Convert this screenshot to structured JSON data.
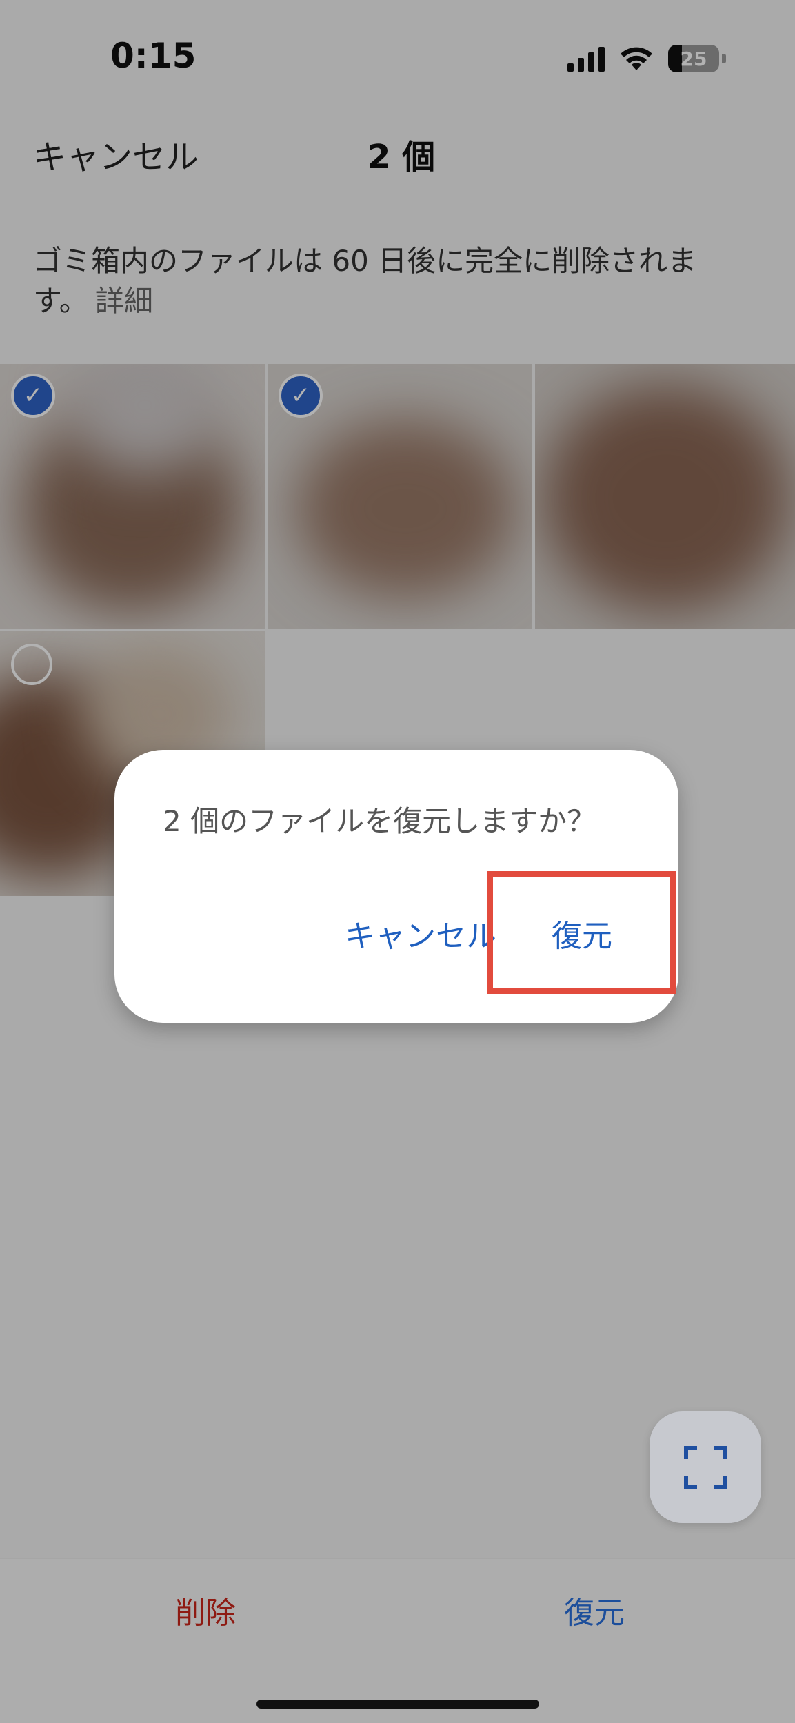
{
  "status_bar": {
    "time": "0:15",
    "battery": "25"
  },
  "header": {
    "cancel_label": "キャンセル",
    "selection_count": "2 個"
  },
  "notice": {
    "text": "ゴミ箱内のファイルは 60 日後に完全に削除されます。",
    "detail_link": "詳細"
  },
  "dialog": {
    "message": "2 個のファイルを復元しますか？",
    "cancel_label": "キャンセル",
    "restore_label": "復元"
  },
  "bottom_bar": {
    "delete_label": "削除",
    "restore_label": "復元"
  },
  "colors": {
    "accent_blue": "#1f5fbf",
    "delete_red": "#8e1a12",
    "highlight_red": "#e24b3d"
  },
  "icons": {
    "fab": "fullscreen-icon",
    "check": "checkmark-icon"
  }
}
